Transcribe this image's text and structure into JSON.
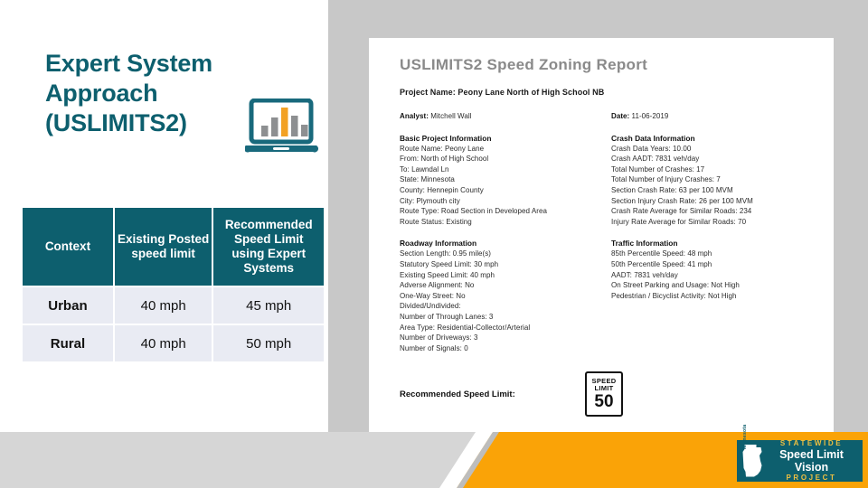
{
  "slide": {
    "title_lines": [
      "Expert System",
      "Approach",
      "(USLIMITS2)"
    ],
    "accent_teal": "#0d5f6e",
    "accent_orange": "#faa307",
    "background_gray": "#c8c8c8"
  },
  "icons": {
    "laptop": "laptop-bar-chart-icon"
  },
  "table": {
    "headers": [
      "Context",
      "Existing Posted speed limit",
      "Recommended Speed Limit using Expert Systems"
    ],
    "header_lines": {
      "col1": [
        "Context"
      ],
      "col2": [
        "Existing Posted",
        "speed limit"
      ],
      "col3": [
        "Recommended",
        "Speed Limit",
        "using Expert",
        "Systems"
      ]
    },
    "rows": [
      {
        "context": "Urban",
        "existing": "40 mph",
        "recommended": "45 mph"
      },
      {
        "context": "Rural",
        "existing": "40 mph",
        "recommended": "50 mph"
      }
    ]
  },
  "report": {
    "title": "USLIMITS2 Speed Zoning Report",
    "project_name": "Project Name: Peony Lane North of High School NB",
    "analyst_label": "Analyst:",
    "analyst_value": "Mitchell Wall",
    "date_label": "Date:",
    "date_value": "11-06-2019",
    "basic": {
      "heading": "Basic Project Information",
      "lines": [
        "Route Name: Peony Lane",
        "From: North of High School",
        "To: Lawndal Ln",
        "State: Minnesota",
        "County: Hennepin County",
        "City: Plymouth city",
        "Route Type: Road Section in Developed Area",
        "Route Status: Existing"
      ]
    },
    "crash": {
      "heading": "Crash Data Information",
      "lines": [
        "Crash Data Years: 10.00",
        "Crash AADT: 7831 veh/day",
        "Total Number of Crashes: 17",
        "Total Number of Injury Crashes: 7",
        "Section Crash Rate: 63 per 100 MVM",
        "Section Injury Crash Rate: 26 per 100 MVM",
        "Crash Rate Average for Similar Roads: 234",
        "Injury Rate Average for Similar Roads: 70"
      ]
    },
    "roadway": {
      "heading": "Roadway Information",
      "lines": [
        "Section Length: 0.95 mile(s)",
        "Statutory Speed Limit: 30 mph",
        "Existing Speed Limit: 40 mph",
        "Adverse Alignment: No",
        "One-Way Street: No",
        "Divided/Undivided:",
        "Number of Through Lanes: 3",
        "Area Type: Residential-Collector/Arterial",
        "Number of Driveways: 3",
        "Number of Signals: 0"
      ]
    },
    "traffic": {
      "heading": "Traffic Information",
      "lines": [
        "85th Percentile Speed: 48 mph",
        "50th Percentile Speed: 41 mph",
        "AADT: 7831 veh/day",
        "On Street Parking and Usage: Not High",
        "Pedestrian / Bicyclist Activity: Not High"
      ]
    },
    "recommended_label": "Recommended Speed Limit:",
    "sign": {
      "line1": "SPEED",
      "line2": "LIMIT",
      "value": "50"
    }
  },
  "logo": {
    "state_label": "Minnesota",
    "line1": "STATEWIDE",
    "line2": "Speed Limit Vision",
    "line3": "PROJECT"
  }
}
